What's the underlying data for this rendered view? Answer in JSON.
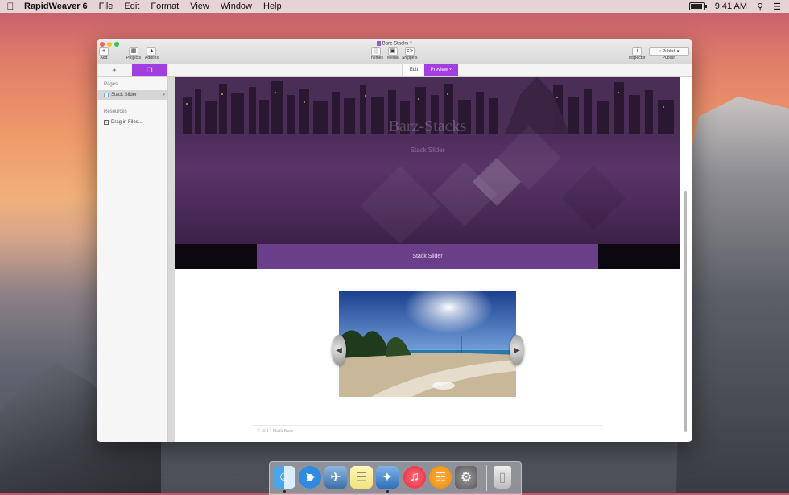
{
  "menubar": {
    "app_name": "RapidWeaver 6",
    "menus": [
      "File",
      "Edit",
      "Format",
      "View",
      "Window",
      "Help"
    ],
    "time": "9:41 AM"
  },
  "window": {
    "title": "Barz-Stacks",
    "toolbar": {
      "add_label": "Add",
      "projects_label": "Projects",
      "addons_label": "Addons",
      "themes_label": "Themes",
      "media_label": "Media",
      "snippets_label": "Snippets",
      "inspector_label": "Inspector",
      "publish_button": "Publish",
      "publish_label": "Publish"
    },
    "modes": {
      "edit": "Edit",
      "preview": "Preview"
    },
    "sidebar": {
      "pages_heading": "Pages",
      "pages": [
        {
          "label": "Stack Slider"
        }
      ],
      "resources_heading": "Resources",
      "resources_item": "Drag in Files..."
    },
    "preview": {
      "site_title": "Barz-Stacks",
      "site_subtitle": "Stack Slider",
      "nav_item": "Stack Slider",
      "footer": "© 2014 Maik Barz"
    }
  },
  "dock": {
    "icons": [
      "finder-icon",
      "safari-icon",
      "photo-icon",
      "notes-icon",
      "xcode-icon",
      "itunes-icon",
      "ibooks-icon",
      "system-preferences-icon",
      "trash-icon"
    ]
  }
}
